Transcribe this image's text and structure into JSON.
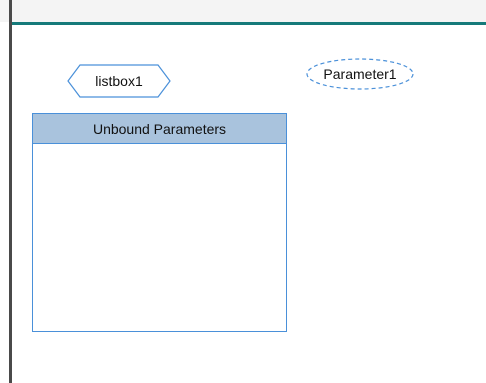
{
  "nodes": {
    "listbox": {
      "label": "listbox1"
    },
    "parameter": {
      "label": "Parameter1"
    }
  },
  "panel": {
    "header": "Unbound Parameters"
  },
  "colors": {
    "canvas_border": "#157a7a",
    "node_stroke": "#4a90d9",
    "panel_header_bg": "#a9c3dd"
  }
}
